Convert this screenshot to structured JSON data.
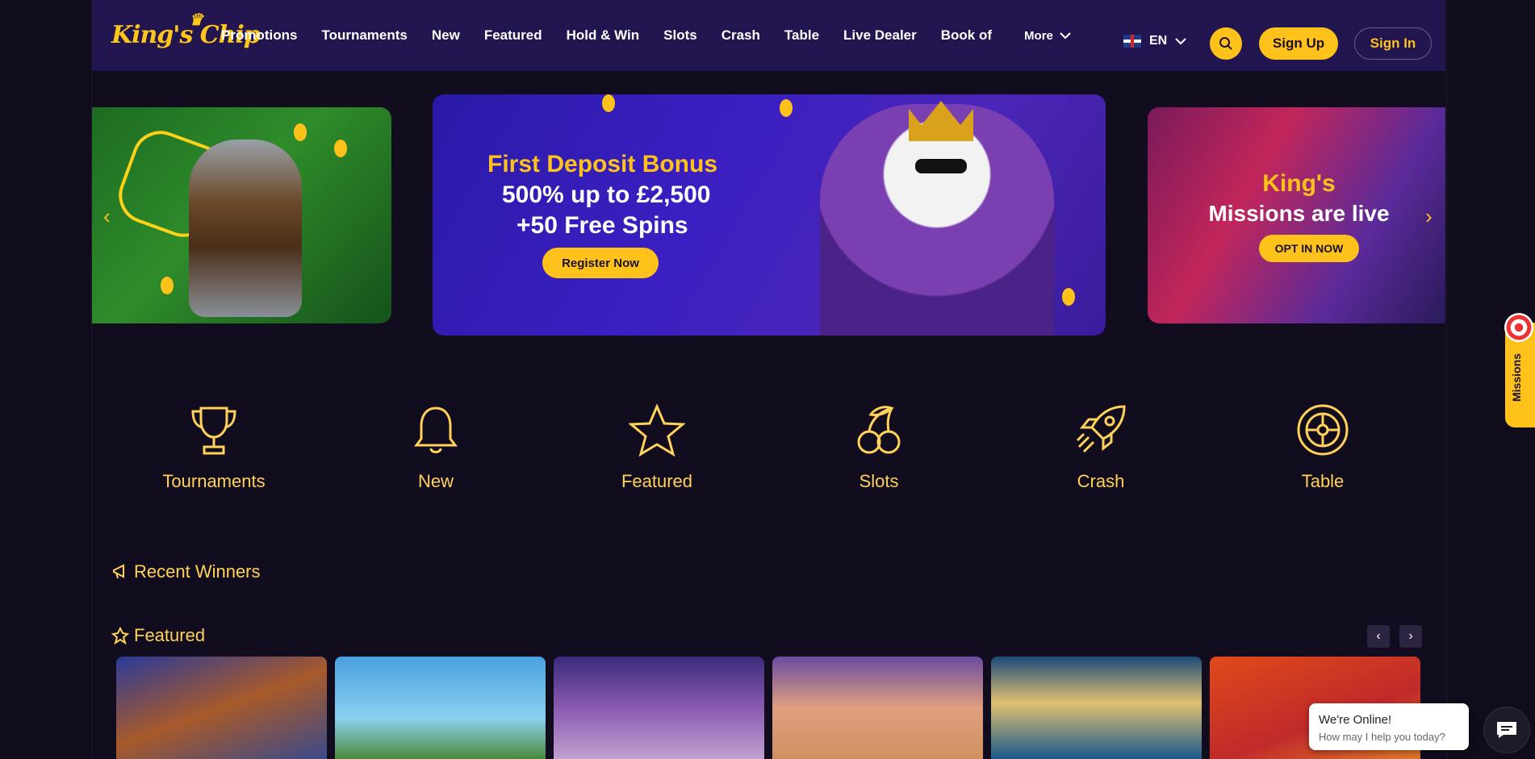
{
  "brand": {
    "logo_text": "King's Chip"
  },
  "nav": {
    "items": [
      "Promotions",
      "Tournaments",
      "New",
      "Featured",
      "Hold & Win",
      "Slots",
      "Crash",
      "Table",
      "Live Dealer",
      "Book of"
    ],
    "more_label": "More"
  },
  "header": {
    "language": "EN",
    "signup_label": "Sign Up",
    "signin_label": "Sign In"
  },
  "banners": {
    "main": {
      "title": "First Deposit Bonus",
      "line1": "500% up to £2,500",
      "line2": "+50 Free Spins",
      "button": "Register Now"
    },
    "right": {
      "title": "King's",
      "subtitle": "Missions are live",
      "button": "OPT IN NOW"
    }
  },
  "categories": [
    {
      "label": "Tournaments",
      "icon": "trophy-icon"
    },
    {
      "label": "New",
      "icon": "bell-icon"
    },
    {
      "label": "Featured",
      "icon": "star-icon"
    },
    {
      "label": "Slots",
      "icon": "cherries-icon"
    },
    {
      "label": "Crash",
      "icon": "rocket-icon"
    },
    {
      "label": "Table",
      "icon": "roulette-icon"
    }
  ],
  "sections": {
    "recent_winners": "Recent Winners",
    "featured": "Featured"
  },
  "side_tab": {
    "label": "Missions"
  },
  "chat": {
    "title": "We're Online!",
    "message": "How may I help you today?"
  },
  "colors": {
    "accent": "#ffc21a",
    "header_bg": "#231650",
    "page_bg": "#120c1f"
  }
}
